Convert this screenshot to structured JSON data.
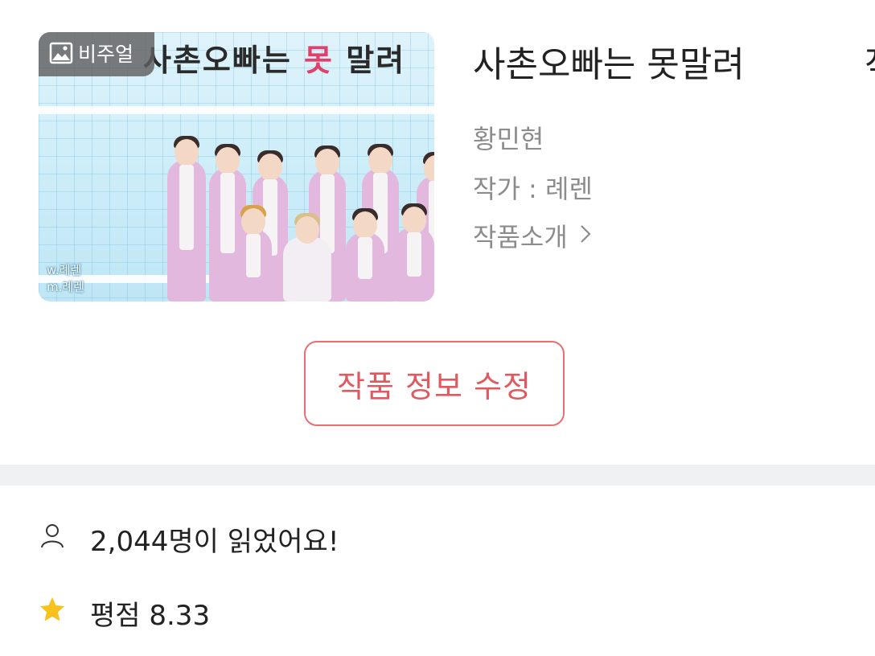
{
  "cover": {
    "badge_label": "비주얼",
    "title_text_a": "사촌오빠는 ",
    "title_text_em": "못",
    "title_text_b": " 말려",
    "credit_writer": "w.례렌",
    "credit_maker": "m.례렌"
  },
  "work": {
    "title": "사촌오빠는 못말려",
    "title_clipped": "작",
    "author_line": "황민현",
    "writer_line": "작가 : 례렌",
    "intro_label": "작품소개"
  },
  "actions": {
    "edit_label": "작품 정보 수정"
  },
  "stats": {
    "readers_text": "2,044명이 읽었어요!",
    "rating_text": "평점 8.33"
  },
  "colors": {
    "accent": "#e0595e",
    "star": "#f7c21b",
    "muted_text": "#8c8c8c"
  },
  "icons": {
    "badge": "image-icon",
    "intro": "chevron-right-icon",
    "readers": "person-icon",
    "rating": "star-icon"
  }
}
